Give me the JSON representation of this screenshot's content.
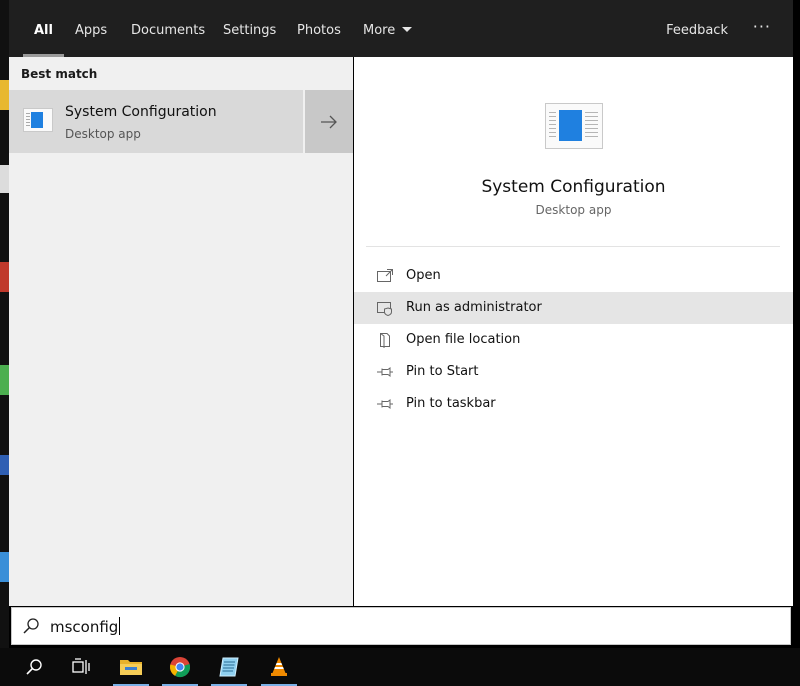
{
  "tabs": [
    {
      "label": "All",
      "active": true
    },
    {
      "label": "Apps"
    },
    {
      "label": "Documents"
    },
    {
      "label": "Settings"
    },
    {
      "label": "Photos"
    },
    {
      "label": "More"
    }
  ],
  "header": {
    "feedback_label": "Feedback",
    "more_options": "···"
  },
  "results": {
    "section_label": "Best match",
    "best_match": {
      "title": "System Configuration",
      "subtitle": "Desktop app",
      "icon": "system-configuration-icon"
    }
  },
  "detail": {
    "title": "System Configuration",
    "subtitle": "Desktop app",
    "actions": [
      {
        "label": "Open",
        "icon": "open-window-icon"
      },
      {
        "label": "Run as administrator",
        "icon": "shield-window-icon",
        "hovered": true
      },
      {
        "label": "Open file location",
        "icon": "file-location-icon"
      },
      {
        "label": "Pin to Start",
        "icon": "pin-icon"
      },
      {
        "label": "Pin to taskbar",
        "icon": "pin-icon"
      }
    ]
  },
  "search": {
    "query": "msconfig"
  },
  "taskbar": {
    "items": [
      "search-icon",
      "task-view-icon",
      "file-explorer-icon",
      "chrome-icon",
      "notepad-icon",
      "vlc-icon"
    ]
  },
  "colors": {
    "accent": "#1f80e0",
    "topbar": "#1f1f1f",
    "results_bg": "#f0f0f0",
    "selected_row": "#d9d9d9"
  }
}
